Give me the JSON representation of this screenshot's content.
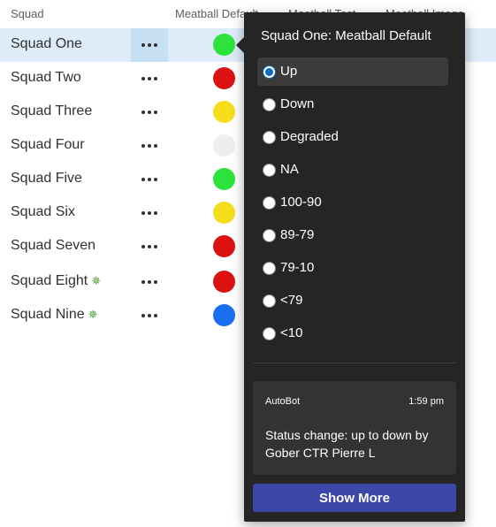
{
  "table": {
    "columns": [
      {
        "label": "Squad"
      },
      {
        "label": "Meatball Default"
      },
      {
        "label": "Meatball Test..."
      },
      {
        "label": "Meatball Image"
      }
    ],
    "rows": [
      {
        "name": "Squad One",
        "status_color": "#2ce23c",
        "new": false
      },
      {
        "name": "Squad Two",
        "status_color": "#dc1212",
        "new": false
      },
      {
        "name": "Squad Three",
        "status_color": "#f5dd1c",
        "new": false
      },
      {
        "name": "Squad Four",
        "status_color": "#eeeeee",
        "new": false
      },
      {
        "name": "Squad Five",
        "status_color": "#2ce23c",
        "new": false
      },
      {
        "name": "Squad Six",
        "status_color": "#f5dd1c",
        "new": false
      },
      {
        "name": "Squad Seven",
        "status_color": "#dc1212",
        "new": false
      },
      {
        "name": "Squad Eight",
        "status_color": "#dc1212",
        "new": true
      },
      {
        "name": "Squad Nine",
        "status_color": "#1a6ff0",
        "new": true
      }
    ],
    "selected_row": "Squad One",
    "more_icon": "ellipsis-icon",
    "new_badge_icon": "sparkle-icon",
    "new_badge_glyph": "✵"
  },
  "popup": {
    "title": "Squad One: Meatball Default",
    "options": [
      {
        "label": "Up",
        "checked": true
      },
      {
        "label": "Down",
        "checked": false
      },
      {
        "label": "Degraded",
        "checked": false
      },
      {
        "label": "NA",
        "checked": false
      },
      {
        "label": "100-90",
        "checked": false
      },
      {
        "label": "89-79",
        "checked": false
      },
      {
        "label": "79-10",
        "checked": false
      },
      {
        "label": "<79",
        "checked": false
      },
      {
        "label": "<10",
        "checked": false
      }
    ],
    "activity": {
      "author": "AutoBot",
      "time": "1:59 pm",
      "message": "Status change: up to down by Gober CTR Pierre L"
    },
    "show_more_label": "Show More"
  },
  "colors": {
    "selected_row": "#deecf9",
    "popup_background": "#252525",
    "button_accent": "#3d47a8",
    "radio_accent": "#0f6cbd"
  }
}
